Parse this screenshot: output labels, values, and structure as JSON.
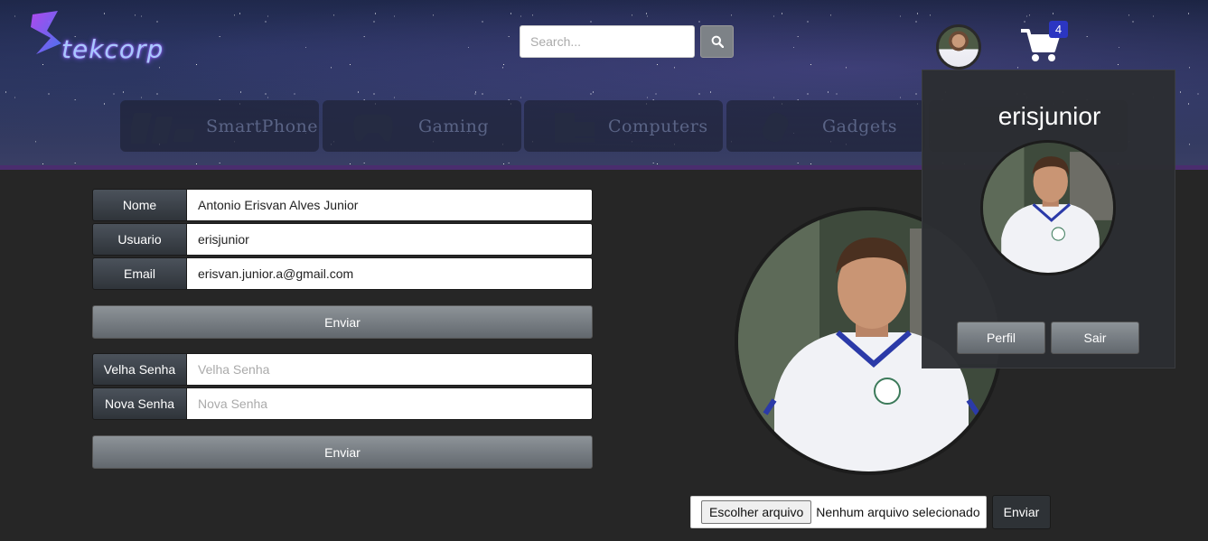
{
  "header": {
    "logo_text": "tekcorp",
    "search": {
      "placeholder": "Search...",
      "value": ""
    },
    "cart_count": "4",
    "categories": [
      {
        "label": "SmartPhone",
        "icon": "smartphones-icon"
      },
      {
        "label": "Gaming",
        "icon": "gamepad-icon"
      },
      {
        "label": "Computers",
        "icon": "computer-icon"
      },
      {
        "label": "Gadgets",
        "icon": "smartwatch-icon"
      }
    ]
  },
  "profile_form": {
    "nome_label": "Nome",
    "nome_value": "Antonio Erisvan Alves Junior",
    "usuario_label": "Usuario",
    "usuario_value": "erisjunior",
    "email_label": "Email",
    "email_value": "erisvan.junior.a@gmail.com",
    "submit_label": "Enviar"
  },
  "password_form": {
    "old_label": "Velha Senha",
    "old_placeholder": "Velha Senha",
    "new_label": "Nova Senha",
    "new_placeholder": "Nova Senha",
    "submit_label": "Enviar"
  },
  "photo_upload": {
    "choose_label": "Escolher arquivo",
    "status": "Nenhum arquivo selecionado",
    "submit_label": "Enviar"
  },
  "user_menu": {
    "username": "erisjunior",
    "profile_label": "Perfil",
    "logout_label": "Sair"
  },
  "colors": {
    "accent_badge": "#2b36c2",
    "header_line": "#4a2d6e",
    "background": "#262626"
  }
}
